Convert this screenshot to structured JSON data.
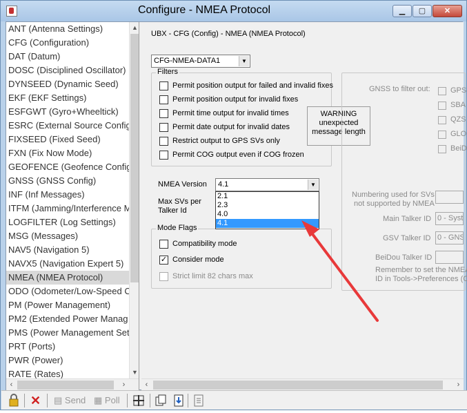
{
  "window": {
    "title": "Configure - NMEA Protocol",
    "controls": {
      "minimize": "▁",
      "maximize": "▢",
      "close": "✕"
    }
  },
  "messages_list": {
    "items": [
      "ANT (Antenna Settings)",
      "CFG (Configuration)",
      "DAT (Datum)",
      "DOSC (Disciplined Oscillator)",
      "DYNSEED (Dynamic Seed)",
      "EKF (EKF Settings)",
      "ESFGWT (Gyro+Wheeltick)",
      "ESRC (External Source Config)",
      "FIXSEED (Fixed Seed)",
      "FXN (Fix Now Mode)",
      "GEOFENCE (Geofence Config)",
      "GNSS (GNSS Config)",
      "INF (Inf Messages)",
      "ITFM (Jamming/Interference M",
      "LOGFILTER (Log Settings)",
      "MSG (Messages)",
      "NAV5 (Navigation 5)",
      "NAVX5 (Navigation Expert 5)",
      "NMEA (NMEA Protocol)",
      "ODO (Odometer/Low-Speed C",
      "PM (Power Management)",
      "PM2 (Extended Power Manag",
      "PMS (Power Management Set",
      "PRT (Ports)",
      "PWR (Power)",
      "RATE (Rates)"
    ],
    "selected_index": 18
  },
  "panel": {
    "header": "UBX - CFG (Config) - NMEA (NMEA Protocol)",
    "data_select": "CFG-NMEA-DATA1",
    "filters": {
      "label": "Filters",
      "options": [
        {
          "label": "Permit position output for failed and invalid fixes",
          "checked": false
        },
        {
          "label": "Permit position output for invalid fixes",
          "checked": false
        },
        {
          "label": "Permit time output for invalid times",
          "checked": false
        },
        {
          "label": "Permit date output for invalid dates",
          "checked": false
        },
        {
          "label": "Restrict output to GPS SVs only",
          "checked": false
        },
        {
          "label": "Permit COG output even if COG frozen",
          "checked": false
        }
      ]
    },
    "warning": {
      "line1": "WARNING",
      "line2": "unexpected",
      "line3": "message length"
    },
    "nmea_version": {
      "label": "NMEA Version",
      "value": "4.1",
      "options": [
        "2.1",
        "2.3",
        "4.0",
        "4.1"
      ],
      "highlighted": "4.1"
    },
    "max_svs": {
      "line1": "Max SVs per",
      "line2": "Talker Id"
    },
    "mode_flags": {
      "label": "Mode Flags",
      "compat": {
        "label": "Compatibility mode",
        "checked": false
      },
      "consider": {
        "label": "Consider mode",
        "checked": true
      },
      "strict": {
        "label": "Strict limit 82 chars max",
        "checked": false
      }
    },
    "gnss_filter": {
      "label": "GNSS to filter out:",
      "items": [
        "GPS",
        "SBA",
        "QZS",
        "GLO",
        "BeiD"
      ]
    },
    "numbering": {
      "line1": "Numbering used for SVs",
      "line2": "not supported by NMEA"
    },
    "main_talker": {
      "label": "Main Talker ID",
      "value": "0 - Syst"
    },
    "gsv_talker": {
      "label": "GSV Talker ID",
      "value": "0 - GNS"
    },
    "beidou_talker": {
      "label": "BeiDou Talker ID"
    },
    "remember": {
      "line1": "Remember to set the NMEA",
      "line2": "ID in Tools->Preferences (C"
    }
  },
  "toolbar": {
    "send": "Send",
    "poll": "Poll"
  },
  "colors": {
    "arrow": "#e8393a",
    "selection": "#3399ff",
    "title_bg": "#b9d1ea"
  }
}
